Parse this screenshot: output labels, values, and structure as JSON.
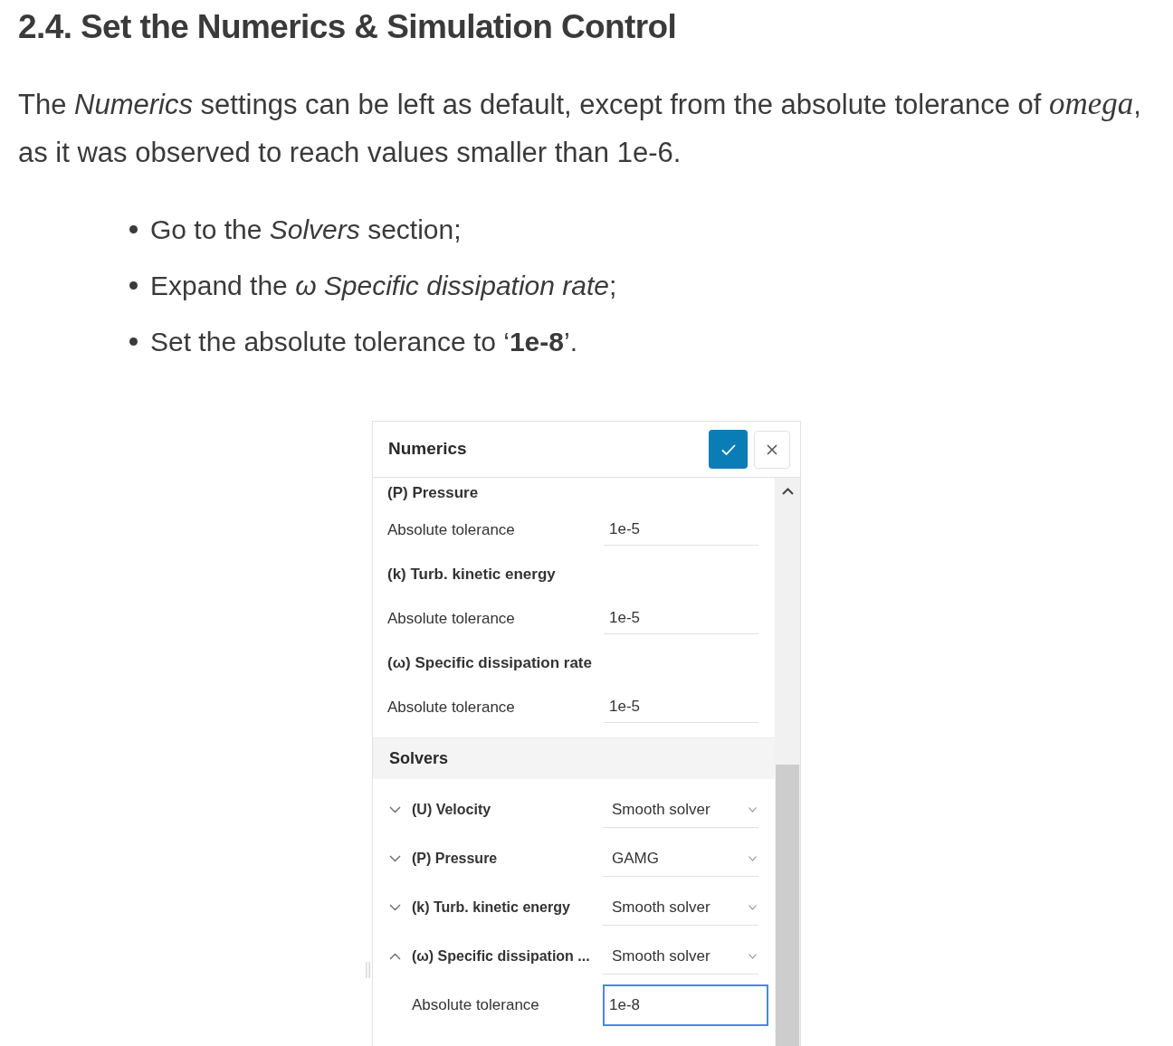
{
  "heading": "2.4. Set the Numerics & Simulation Control",
  "intro": [
    {
      "kind": "plain",
      "text": "The "
    },
    {
      "kind": "italic",
      "text": "Numerics"
    },
    {
      "kind": "plain",
      "text": " settings can be left as default, except from the absolute tolerance of "
    },
    {
      "kind": "math",
      "text": "omega"
    },
    {
      "kind": "plain",
      "text": ", as it was observed to reach values smaller than 1e-6."
    }
  ],
  "steps": [
    "Go to the *Solvers* section;",
    "Expand the *ω Specific dissipation rate*;",
    "Set the absolute tolerance to ‘**1e-8**’."
  ],
  "panel": {
    "title": "Numerics",
    "tolerances": [
      {
        "group": "(P) Pressure",
        "label": "Absolute tolerance",
        "value": "1e-5"
      },
      {
        "group": "(k) Turb. kinetic energy",
        "label": "Absolute tolerance",
        "value": "1e-5"
      },
      {
        "group": "(ω) Specific dissipation rate",
        "label": "Absolute tolerance",
        "value": "1e-5"
      }
    ],
    "solvers": {
      "title": "Solvers",
      "rows": [
        {
          "label": "(U) Velocity",
          "solver": "Smooth solver",
          "expanded": false
        },
        {
          "label": "(P) Pressure",
          "solver": "GAMG",
          "expanded": false
        },
        {
          "label": "(k) Turb. kinetic energy",
          "solver": "Smooth solver",
          "expanded": false
        },
        {
          "label": "(ω) Specific dissipation ...",
          "solver": "Smooth solver",
          "expanded": true,
          "fields": [
            {
              "label": "Absolute tolerance",
              "value": "1e-8",
              "focused": true
            }
          ]
        }
      ]
    }
  }
}
